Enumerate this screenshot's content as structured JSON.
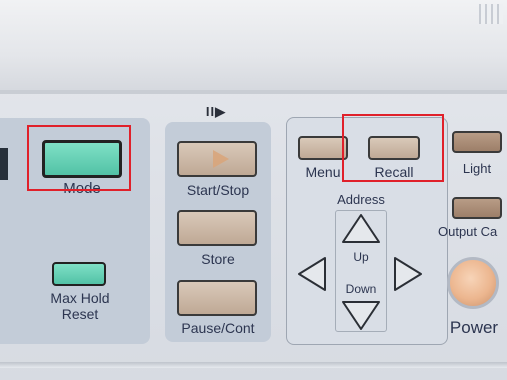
{
  "labels": {
    "mode": "Mode",
    "max_hold_line1": "Max Hold",
    "max_hold_line2": "Reset",
    "play_pause_symbol": "II▶",
    "start_stop": "Start/Stop",
    "store": "Store",
    "pause_cont": "Pause/Cont",
    "menu": "Menu",
    "recall": "Recall",
    "address": "Address",
    "up": "Up",
    "down": "Down",
    "light": "Light",
    "output_ca": "Output Ca",
    "power": "Power"
  },
  "colors": {
    "highlight": "#e0202a",
    "green_button": "#5ccfb2",
    "tan_button": "#cdb9a6",
    "panel": "#c3ccd8",
    "label_text": "#2c3550"
  },
  "highlighted_controls": [
    "Mode",
    "Recall"
  ],
  "icons": {
    "start_stop": "play-triangle-icon",
    "arrow_up": "arrow-up-icon",
    "arrow_down": "arrow-down-icon",
    "arrow_left": "arrow-left-icon",
    "arrow_right": "arrow-right-icon"
  }
}
